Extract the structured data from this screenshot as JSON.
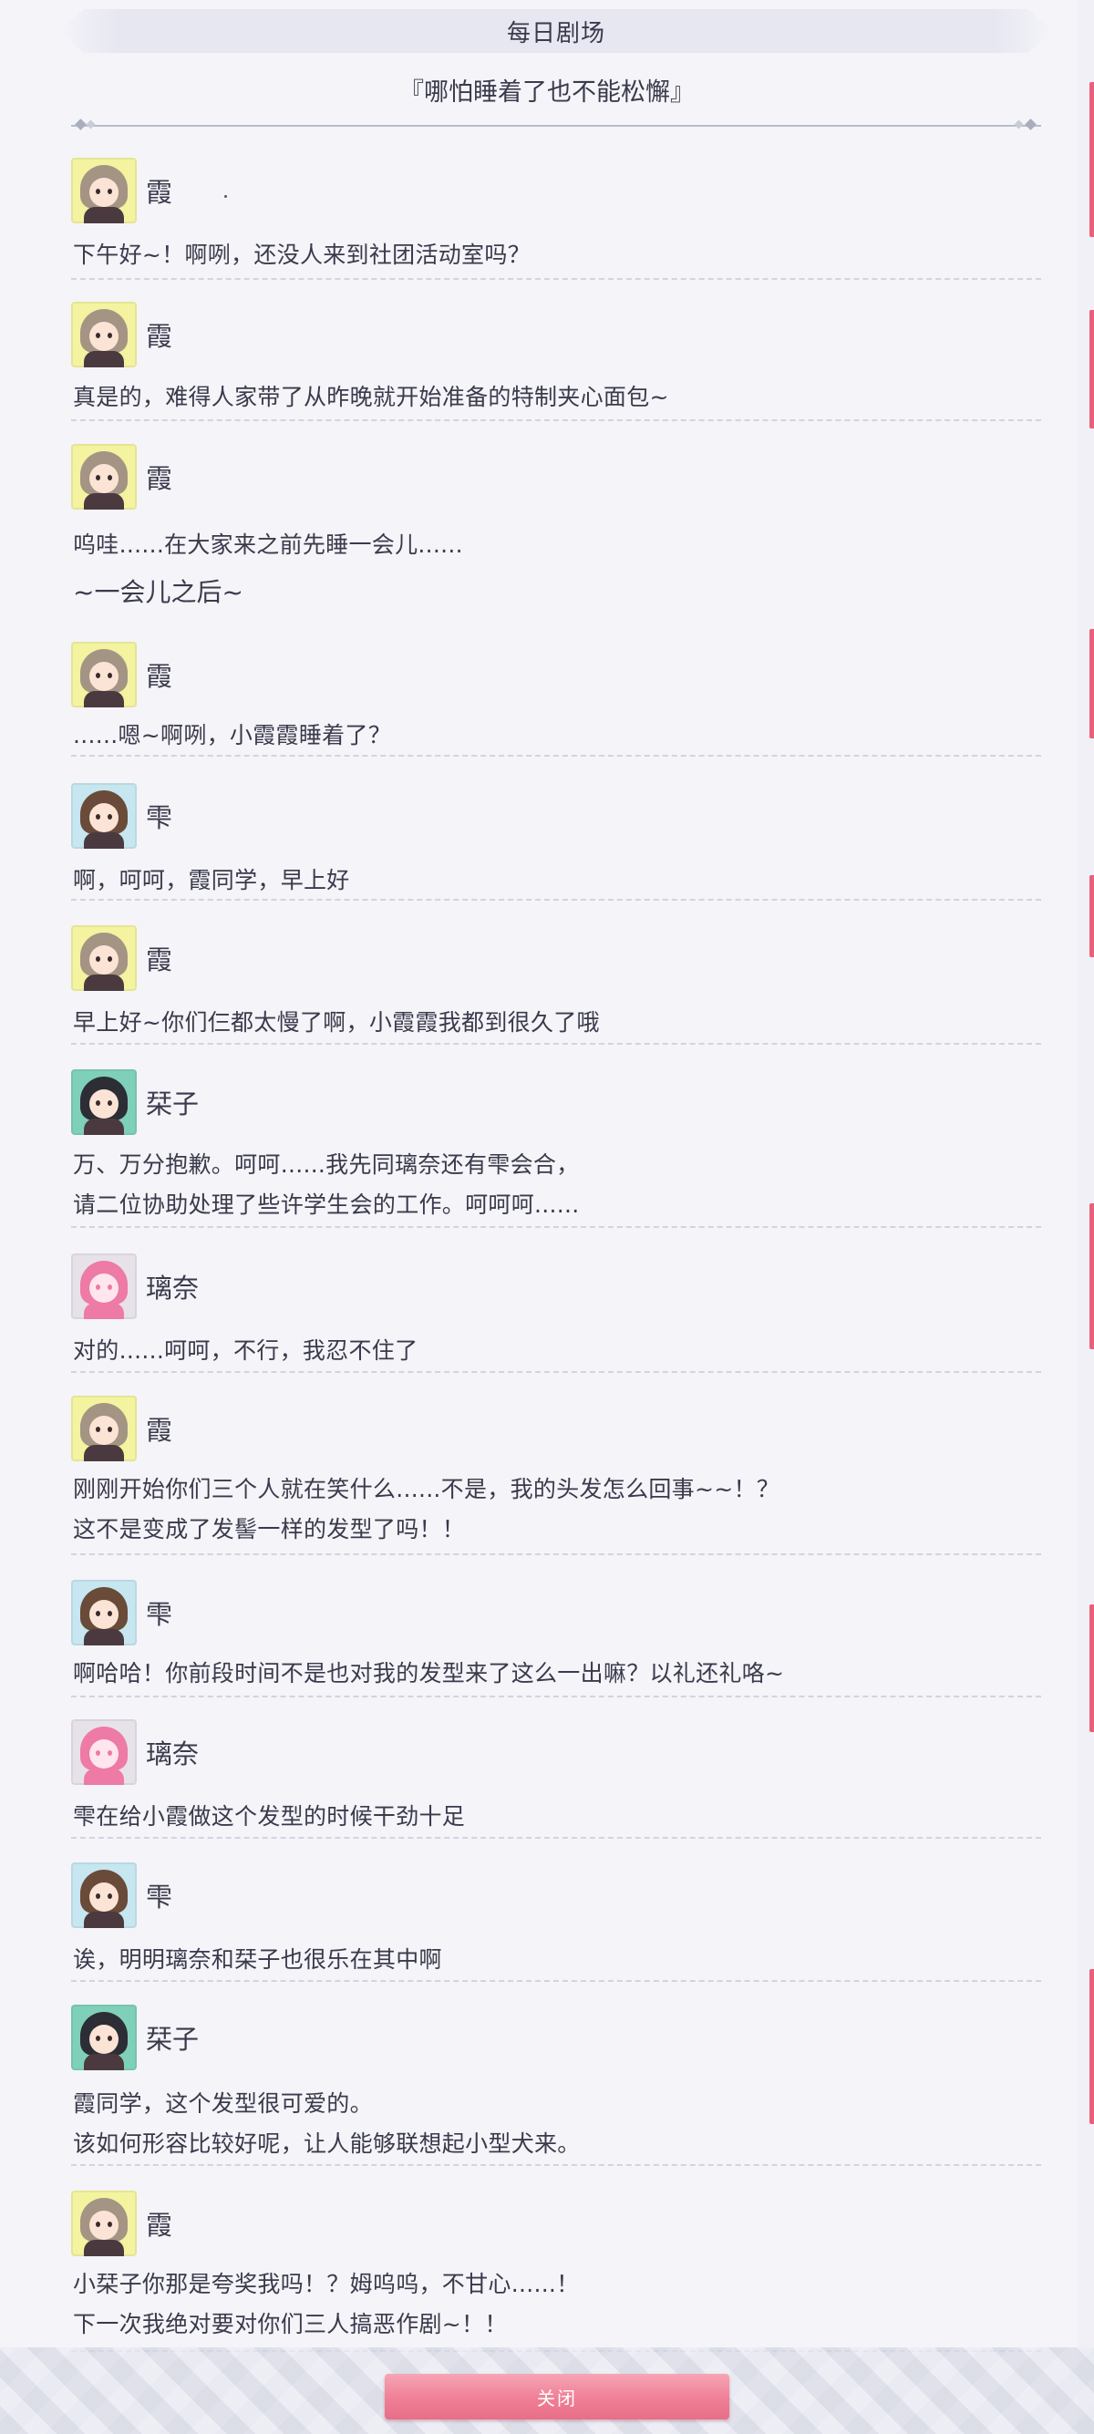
{
  "header": {
    "title": "每日剧场",
    "subtitle": "『哪怕睡着了也不能松懈』"
  },
  "characters": {
    "kasumi": {
      "name": "霞",
      "icon": "kasumi-avatar-icon",
      "bg": "#f3f3a0",
      "hair": "#a49484"
    },
    "shizuku": {
      "name": "雫",
      "icon": "shizuku-avatar-icon",
      "bg": "#c6e6f0",
      "hair": "#6a4a38"
    },
    "shioriko": {
      "name": "栞子",
      "icon": "shioriko-avatar-icon",
      "bg": "#7fd0b8",
      "hair": "#2d2d35"
    },
    "rina": {
      "name": "璃奈",
      "icon": "rina-avatar-icon",
      "bg": "#e7e2ea",
      "hair": "#ee7aa6"
    }
  },
  "entries": [
    {
      "speaker": "霞",
      "lines": [
        "下午好~！啊咧，还没人来到社团活动室吗？"
      ]
    },
    {
      "speaker": "霞",
      "lines": [
        "真是的，难得人家带了从昨晚就开始准备的特制夹心面包~"
      ]
    },
    {
      "speaker": "霞",
      "lines": [
        "呜哇......在大家来之前先睡一会儿......"
      ]
    },
    {
      "speaker": "霞",
      "lines": [
        "......嗯~啊咧，小霞霞睡着了？"
      ]
    },
    {
      "speaker": "雫",
      "lines": [
        "啊，呵呵，霞同学，早上好"
      ]
    },
    {
      "speaker": "霞",
      "lines": [
        "早上好~你们仨都太慢了啊，小霞霞我都到很久了哦"
      ]
    },
    {
      "speaker": "栞子",
      "lines": [
        "万、万分抱歉。呵呵......我先同璃奈还有雫会合，",
        "请二位协助处理了些许学生会的工作。呵呵呵......"
      ]
    },
    {
      "speaker": "璃奈",
      "lines": [
        "对的......呵呵，不行，我忍不住了"
      ]
    },
    {
      "speaker": "霞",
      "lines": [
        "刚刚开始你们三个人就在笑什么......不是，我的头发怎么回事~~！？",
        "这不是变成了发髻一样的发型了吗！！"
      ]
    },
    {
      "speaker": "雫",
      "lines": [
        "啊哈哈！你前段时间不是也对我的发型来了这么一出嘛？以礼还礼咯~"
      ]
    },
    {
      "speaker": "璃奈",
      "lines": [
        "雫在给小霞做这个发型的时候干劲十足"
      ]
    },
    {
      "speaker": "雫",
      "lines": [
        "诶，明明璃奈和栞子也很乐在其中啊"
      ]
    },
    {
      "speaker": "栞子",
      "lines": [
        "霞同学，这个发型很可爱的。",
        "该如何形容比较好呢，让人能够联想起小型犬来。"
      ]
    },
    {
      "speaker": "霞",
      "lines": [
        "小栞子你那是夸奖我吗！？姆呜呜，不甘心......！",
        "下一次我绝对要对你们三人搞恶作剧~！！"
      ]
    }
  ],
  "scene_note": "~一会儿之后~",
  "footer": {
    "close_label": "关闭"
  },
  "colors": {
    "accent": "#ef7f96",
    "background": "#f4f4f9",
    "text": "#3a3a4c"
  }
}
